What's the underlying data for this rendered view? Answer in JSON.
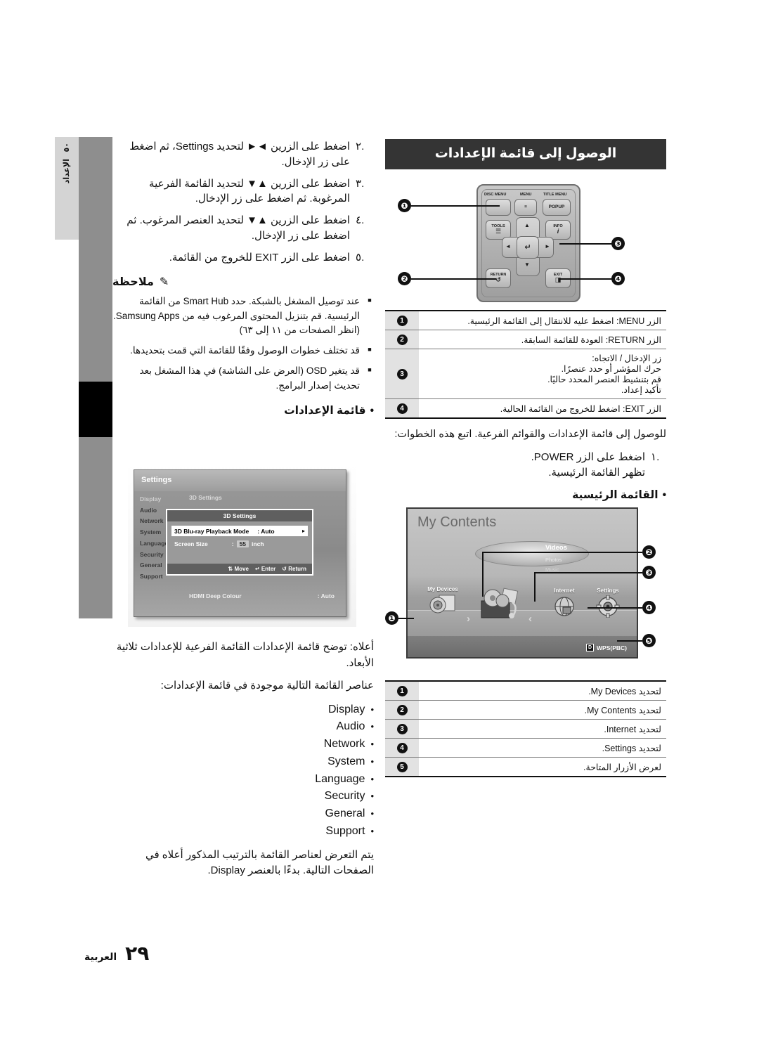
{
  "side_tab": {
    "number": "٥٠",
    "label": "الإعداد"
  },
  "left_column": {
    "steps": [
      {
        "num": "٢.",
        "text": "اضغط على الزرين ◄► لتحديد Settings، ثم اضغط على زر الإدخال."
      },
      {
        "num": "٣.",
        "text": "اضغط على الزرين ▲▼ لتحديد القائمة الفرعية المرغوبة. ثم اضغط على زر الإدخال."
      },
      {
        "num": "٤.",
        "text": "اضغط على الزرين ▲▼ لتحديد العنصر المرغوب. ثم اضغط على زر الإدخال."
      },
      {
        "num": "٥.",
        "text": "اضغط على الزر EXIT للخروج من القائمة."
      }
    ],
    "note_heading": "ملاحظة",
    "note_icon": "✎",
    "notes": [
      "عند توصيل المشغل بالشبكة. حدد Smart Hub من القائمة الرئيسية.\nقم بتنزيل المحتوى المرغوب فيه من Samsung Apps. (انظر الصفحات من ١١ إلى ٦٣)",
      "قد تختلف خطوات الوصول وفقًا للقائمة التي قمت بتحديدها.",
      "قد يتغير OSD (العرض على الشاشة) في هذا المشغل بعد تحديث إصدار البرامج."
    ],
    "settings_menu_heading": "قائمة الإعدادات",
    "caption_above": "أعلاه: توضح قائمة الإعدادات القائمة الفرعية للإعدادات ثلاثية الأبعاد.",
    "caption_items_intro": "عناصر القائمة التالية موجودة في قائمة الإعدادات:",
    "menu_items": [
      "Display",
      "Audio",
      "Network",
      "System",
      "Language",
      "Security",
      "General",
      "Support"
    ],
    "caption_below": "يتم التعرض لعناصر القائمة بالترتيب المذكور أعلاه في الصفحات التالية. بدءًا بالعنصر Display."
  },
  "settings_screenshot": {
    "title": "Settings",
    "sidebar": [
      "Display",
      "Audio",
      "Network",
      "System",
      "Language",
      "Security",
      "General",
      "Support"
    ],
    "selected_sidebar": "Display",
    "submenu_label": "3D Settings",
    "popup": {
      "header": "3D Settings",
      "rows": [
        {
          "label": "3D Blu-ray Playback Mode",
          "sep": ":",
          "value": "Auto",
          "arrow": "▸"
        },
        {
          "label": "Screen Size",
          "sep": ":",
          "value": "55",
          "unit": "inch"
        }
      ],
      "footer": [
        {
          "icon": "⇅",
          "label": "Move"
        },
        {
          "icon": "↵",
          "label": "Enter"
        },
        {
          "icon": "↺",
          "label": "Return"
        }
      ]
    },
    "bottom_row_label": "HDMI Deep Colour",
    "bottom_row_value": ": Auto"
  },
  "right_column": {
    "page_title": "الوصول إلى قائمة الإعدادات",
    "remote": {
      "labels": {
        "disc_menu": "DISC MENU",
        "menu": "MENU",
        "title_menu": "TITLE MENU",
        "popup": "POPUP",
        "tools": "TOOLS",
        "info": "INFO",
        "info_glyph": "i",
        "return": "RETURN",
        "return_glyph": "↺",
        "exit": "EXIT",
        "menu_glyph": "≡",
        "tools_glyph": "☰",
        "enter_glyph": "↵",
        "up": "▲",
        "down": "▼",
        "left": "◄",
        "right": "►",
        "exit_glyph": "◨"
      },
      "callouts": [
        "❶",
        "❷",
        "❸",
        "❹"
      ]
    },
    "remote_legend": [
      {
        "n": "1",
        "text": "الزر MENU: اضغط عليه للانتقال إلى القائمة الرئيسية."
      },
      {
        "n": "2",
        "text": "الزر RETURN: العودة للقائمة السابقة."
      },
      {
        "n": "3",
        "text": "زر الإدخال / الاتجاه:\nحرك المؤشر أو حدد عنصرًا.\nقم بتنشيط العنصر المحدد حاليًا.\nتأكيد إعداد."
      },
      {
        "n": "4",
        "text": "الزر EXIT: اضغط للخروج من القائمة الحالية."
      }
    ],
    "intro_para": "للوصول إلى قائمة الإعدادات والقوائم الفرعية. اتبع هذه الخطوات:",
    "step1_num": "١.",
    "step1_text": "اضغط على الزر POWER.\nتظهر القائمة الرئيسية.",
    "main_menu_heading": "القائمة الرئيسية",
    "mycontents": {
      "title": "My Contents",
      "disc_labels": [
        "Videos",
        "Photos",
        "Music"
      ],
      "icons": [
        {
          "caption": "My Devices",
          "glyph": "●"
        },
        {
          "caption": "",
          "glyph": "■"
        },
        {
          "caption": "Internet",
          "glyph": "●"
        },
        {
          "caption": "Settings",
          "glyph": "⚙"
        }
      ],
      "chev_left": "‹",
      "chev_right": "›",
      "wps_key": "D",
      "wps_label": "WPS(PBC)",
      "callouts": [
        "❶",
        "❷",
        "❸",
        "❹",
        "❺"
      ]
    },
    "mycontents_legend": [
      {
        "n": "1",
        "text": "لتحديد My Devices."
      },
      {
        "n": "2",
        "text": "لتحديد My Contents."
      },
      {
        "n": "3",
        "text": "لتحديد Internet."
      },
      {
        "n": "4",
        "text": "لتحديد Settings."
      },
      {
        "n": "5",
        "text": "لعرض الأزرار المتاحة."
      }
    ]
  },
  "footer": {
    "page_number": "٢٩",
    "language": "العربية"
  },
  "colors": {
    "title_bar": "#343434",
    "sidebar_gray": "#8e8e8e",
    "sidebar_light": "#d4d4d4",
    "table_cell": "#e2e2e2"
  }
}
